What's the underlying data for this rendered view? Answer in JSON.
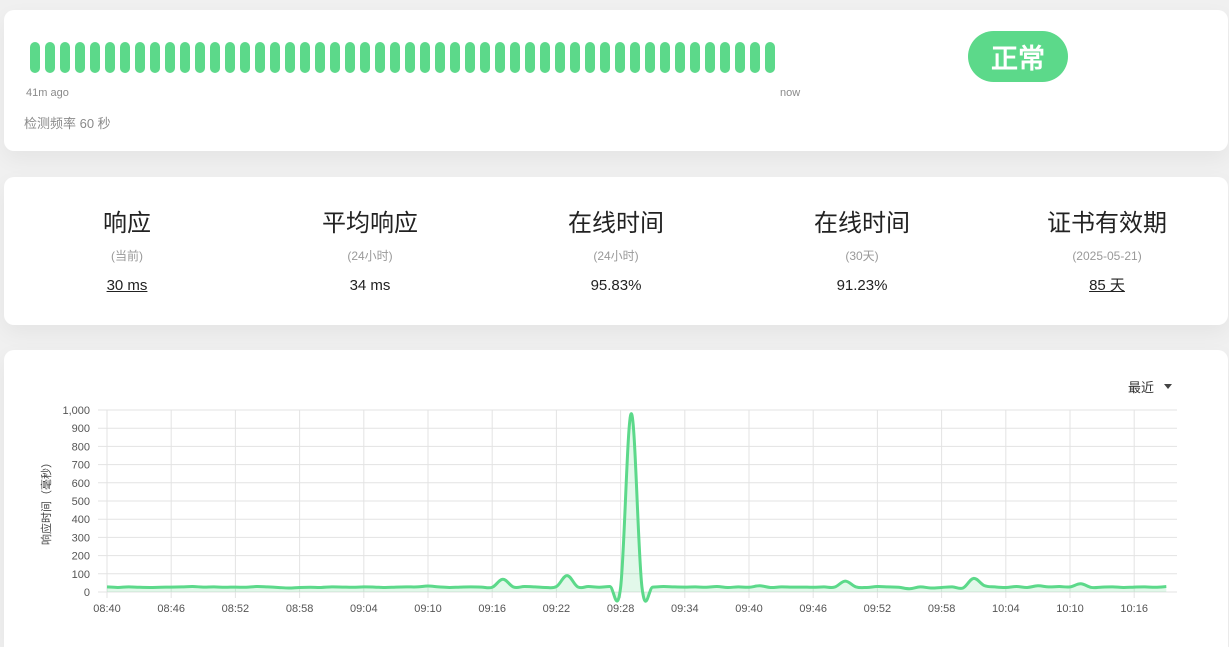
{
  "heartbeat": {
    "beats": [
      "up",
      "up",
      "up",
      "up",
      "up",
      "up",
      "up",
      "up",
      "up",
      "up",
      "up",
      "up",
      "up",
      "up",
      "up",
      "up",
      "up",
      "up",
      "up",
      "up",
      "up",
      "up",
      "up",
      "up",
      "up",
      "up",
      "up",
      "up",
      "up",
      "up",
      "up",
      "up",
      "up",
      "up",
      "up",
      "up",
      "up",
      "up",
      "up",
      "up",
      "up",
      "up",
      "up",
      "up",
      "up",
      "up",
      "up",
      "up",
      "up",
      "up"
    ],
    "start_label": "41m ago",
    "end_label": "now",
    "interval_text": "检测频率 60 秒",
    "status_label": "正常",
    "up_color": "#5cd98a"
  },
  "stats": [
    {
      "title": "响应",
      "sub": "(当前)",
      "value": "30 ms",
      "link": true
    },
    {
      "title": "平均响应",
      "sub": "(24小时)",
      "value": "34 ms",
      "link": false
    },
    {
      "title": "在线时间",
      "sub": "(24小时)",
      "value": "95.83%",
      "link": false
    },
    {
      "title": "在线时间",
      "sub": "(30天)",
      "value": "91.23%",
      "link": false
    },
    {
      "title": "证书有效期",
      "sub": "(2025-05-21)",
      "value": "85 天",
      "link": true
    }
  ],
  "chart": {
    "period_label": "最近",
    "color": "#5cd98a"
  },
  "chart_data": {
    "type": "area",
    "ylabel": "响应时间（毫秒）",
    "xlabel": "",
    "ylim": [
      0,
      1000
    ],
    "y_ticks": [
      "0",
      "100",
      "200",
      "300",
      "400",
      "500",
      "600",
      "700",
      "800",
      "900",
      "1,000"
    ],
    "x_tick_labels": [
      "08:40",
      "08:46",
      "08:52",
      "08:58",
      "09:04",
      "09:10",
      "09:16",
      "09:22",
      "09:28",
      "09:34",
      "09:40",
      "09:46",
      "09:52",
      "09:58",
      "10:04",
      "10:10",
      "10:16"
    ],
    "grid": true,
    "series": [
      {
        "x": [
          "08:40",
          "08:41",
          "08:42",
          "08:43",
          "08:44",
          "08:45",
          "08:46",
          "08:47",
          "08:48",
          "08:49",
          "08:50",
          "08:51",
          "08:52",
          "08:53",
          "08:54",
          "08:55",
          "08:56",
          "08:57",
          "08:58",
          "08:59",
          "09:00",
          "09:01",
          "09:02",
          "09:03",
          "09:04",
          "09:05",
          "09:06",
          "09:07",
          "09:08",
          "09:09",
          "09:10",
          "09:11",
          "09:12",
          "09:13",
          "09:14",
          "09:15",
          "09:16",
          "09:17",
          "09:18",
          "09:19",
          "09:20",
          "09:21",
          "09:22",
          "09:23",
          "09:24",
          "09:25",
          "09:26",
          "09:27",
          "09:28",
          "09:29",
          "09:30",
          "09:31",
          "09:32",
          "09:33",
          "09:34",
          "09:35",
          "09:36",
          "09:37",
          "09:38",
          "09:39",
          "09:40",
          "09:41",
          "09:42",
          "09:43",
          "09:44",
          "09:45",
          "09:46",
          "09:47",
          "09:48",
          "09:49",
          "09:50",
          "09:51",
          "09:52",
          "09:53",
          "09:54",
          "09:55",
          "09:56",
          "09:57",
          "09:58",
          "09:59",
          "10:00",
          "10:01",
          "10:02",
          "10:03",
          "10:04",
          "10:05",
          "10:06",
          "10:07",
          "10:08",
          "10:09",
          "10:10",
          "10:11",
          "10:12",
          "10:13",
          "10:14",
          "10:15",
          "10:16",
          "10:17",
          "10:18",
          "10:19"
        ],
        "values": [
          28,
          25,
          28,
          26,
          25,
          26,
          27,
          28,
          30,
          27,
          28,
          26,
          27,
          26,
          30,
          28,
          25,
          22,
          25,
          26,
          25,
          28,
          27,
          26,
          28,
          27,
          25,
          27,
          28,
          28,
          33,
          28,
          25,
          27,
          28,
          27,
          26,
          70,
          27,
          30,
          28,
          25,
          30,
          90,
          28,
          30,
          26,
          30,
          25,
          980,
          25,
          27,
          30,
          28,
          27,
          28,
          26,
          30,
          25,
          28,
          26,
          34,
          25,
          28,
          27,
          27,
          26,
          28,
          27,
          60,
          28,
          25,
          30,
          28,
          26,
          18,
          28,
          22,
          25,
          28,
          22,
          75,
          35,
          28,
          25,
          30,
          25,
          34,
          28,
          30,
          28,
          45,
          25,
          27,
          28,
          25,
          27,
          28,
          26,
          30
        ]
      }
    ]
  }
}
